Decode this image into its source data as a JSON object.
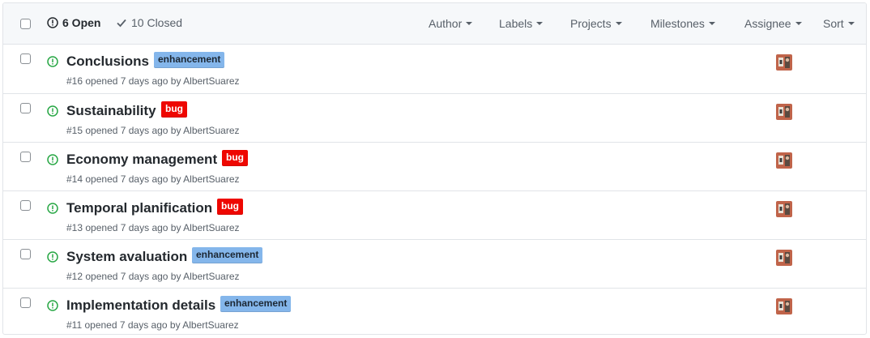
{
  "header": {
    "open_label": "6 Open",
    "closed_label": "10 Closed",
    "filters": {
      "author": "Author",
      "labels": "Labels",
      "projects": "Projects",
      "milestones": "Milestones",
      "assignee": "Assignee",
      "sort": "Sort"
    }
  },
  "colors": {
    "open_icon": "#28a745",
    "enhancement_label": "#84b6eb",
    "bug_label": "#ee0701"
  },
  "issues": [
    {
      "title": "Conclusions",
      "label": "enhancement",
      "label_type": "enhancement",
      "number": "#16",
      "opened": "opened 7 days ago by",
      "author": "AlbertSuarez"
    },
    {
      "title": "Sustainability",
      "label": "bug",
      "label_type": "bug",
      "number": "#15",
      "opened": "opened 7 days ago by",
      "author": "AlbertSuarez"
    },
    {
      "title": "Economy management",
      "label": "bug",
      "label_type": "bug",
      "number": "#14",
      "opened": "opened 7 days ago by",
      "author": "AlbertSuarez"
    },
    {
      "title": "Temporal planification",
      "label": "bug",
      "label_type": "bug",
      "number": "#13",
      "opened": "opened 7 days ago by",
      "author": "AlbertSuarez"
    },
    {
      "title": "System avaluation",
      "label": "enhancement",
      "label_type": "enhancement",
      "number": "#12",
      "opened": "opened 7 days ago by",
      "author": "AlbertSuarez"
    },
    {
      "title": "Implementation details",
      "label": "enhancement",
      "label_type": "enhancement",
      "number": "#11",
      "opened": "opened 7 days ago by",
      "author": "AlbertSuarez"
    }
  ]
}
